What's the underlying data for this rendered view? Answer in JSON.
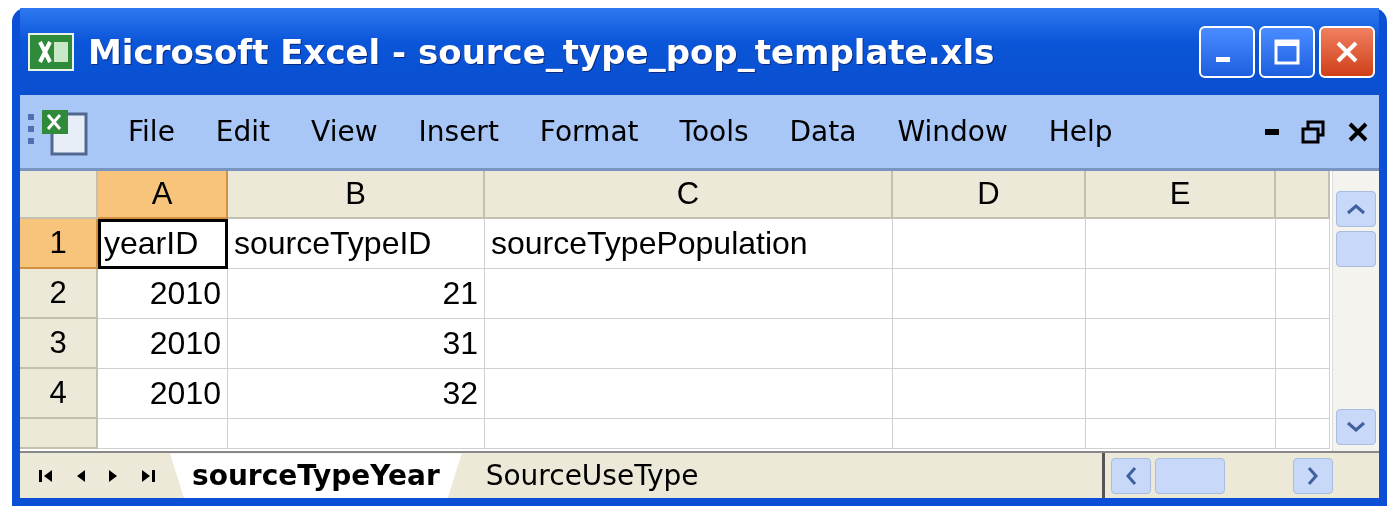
{
  "window": {
    "title": "Microsoft Excel - source_type_pop_template.xls"
  },
  "menu": [
    "File",
    "Edit",
    "View",
    "Insert",
    "Format",
    "Tools",
    "Data",
    "Window",
    "Help"
  ],
  "sheet": {
    "columns": [
      {
        "label": "A",
        "selected": true
      },
      {
        "label": "B",
        "selected": false
      },
      {
        "label": "C",
        "selected": false
      },
      {
        "label": "D",
        "selected": false
      },
      {
        "label": "E",
        "selected": false
      }
    ],
    "rows": [
      {
        "label": "1",
        "selected": true,
        "cells": [
          {
            "text": "yearID",
            "kind": "text",
            "active": true
          },
          {
            "text": "sourceTypeID",
            "kind": "text",
            "active": false
          },
          {
            "text": "sourceTypePopulation",
            "kind": "text",
            "active": false
          }
        ]
      },
      {
        "label": "2",
        "selected": false,
        "cells": [
          {
            "text": "2010",
            "kind": "number",
            "active": false
          },
          {
            "text": "21",
            "kind": "number",
            "active": false
          }
        ]
      },
      {
        "label": "3",
        "selected": false,
        "cells": [
          {
            "text": "2010",
            "kind": "number",
            "active": false
          },
          {
            "text": "31",
            "kind": "number",
            "active": false
          }
        ]
      },
      {
        "label": "4",
        "selected": false,
        "cells": [
          {
            "text": "2010",
            "kind": "number",
            "active": false
          },
          {
            "text": "32",
            "kind": "number",
            "active": false
          }
        ]
      }
    ]
  },
  "sheet_tabs": [
    {
      "label": "sourceTypeYear",
      "selected": true
    },
    {
      "label": "SourceUseType",
      "selected": false
    }
  ]
}
